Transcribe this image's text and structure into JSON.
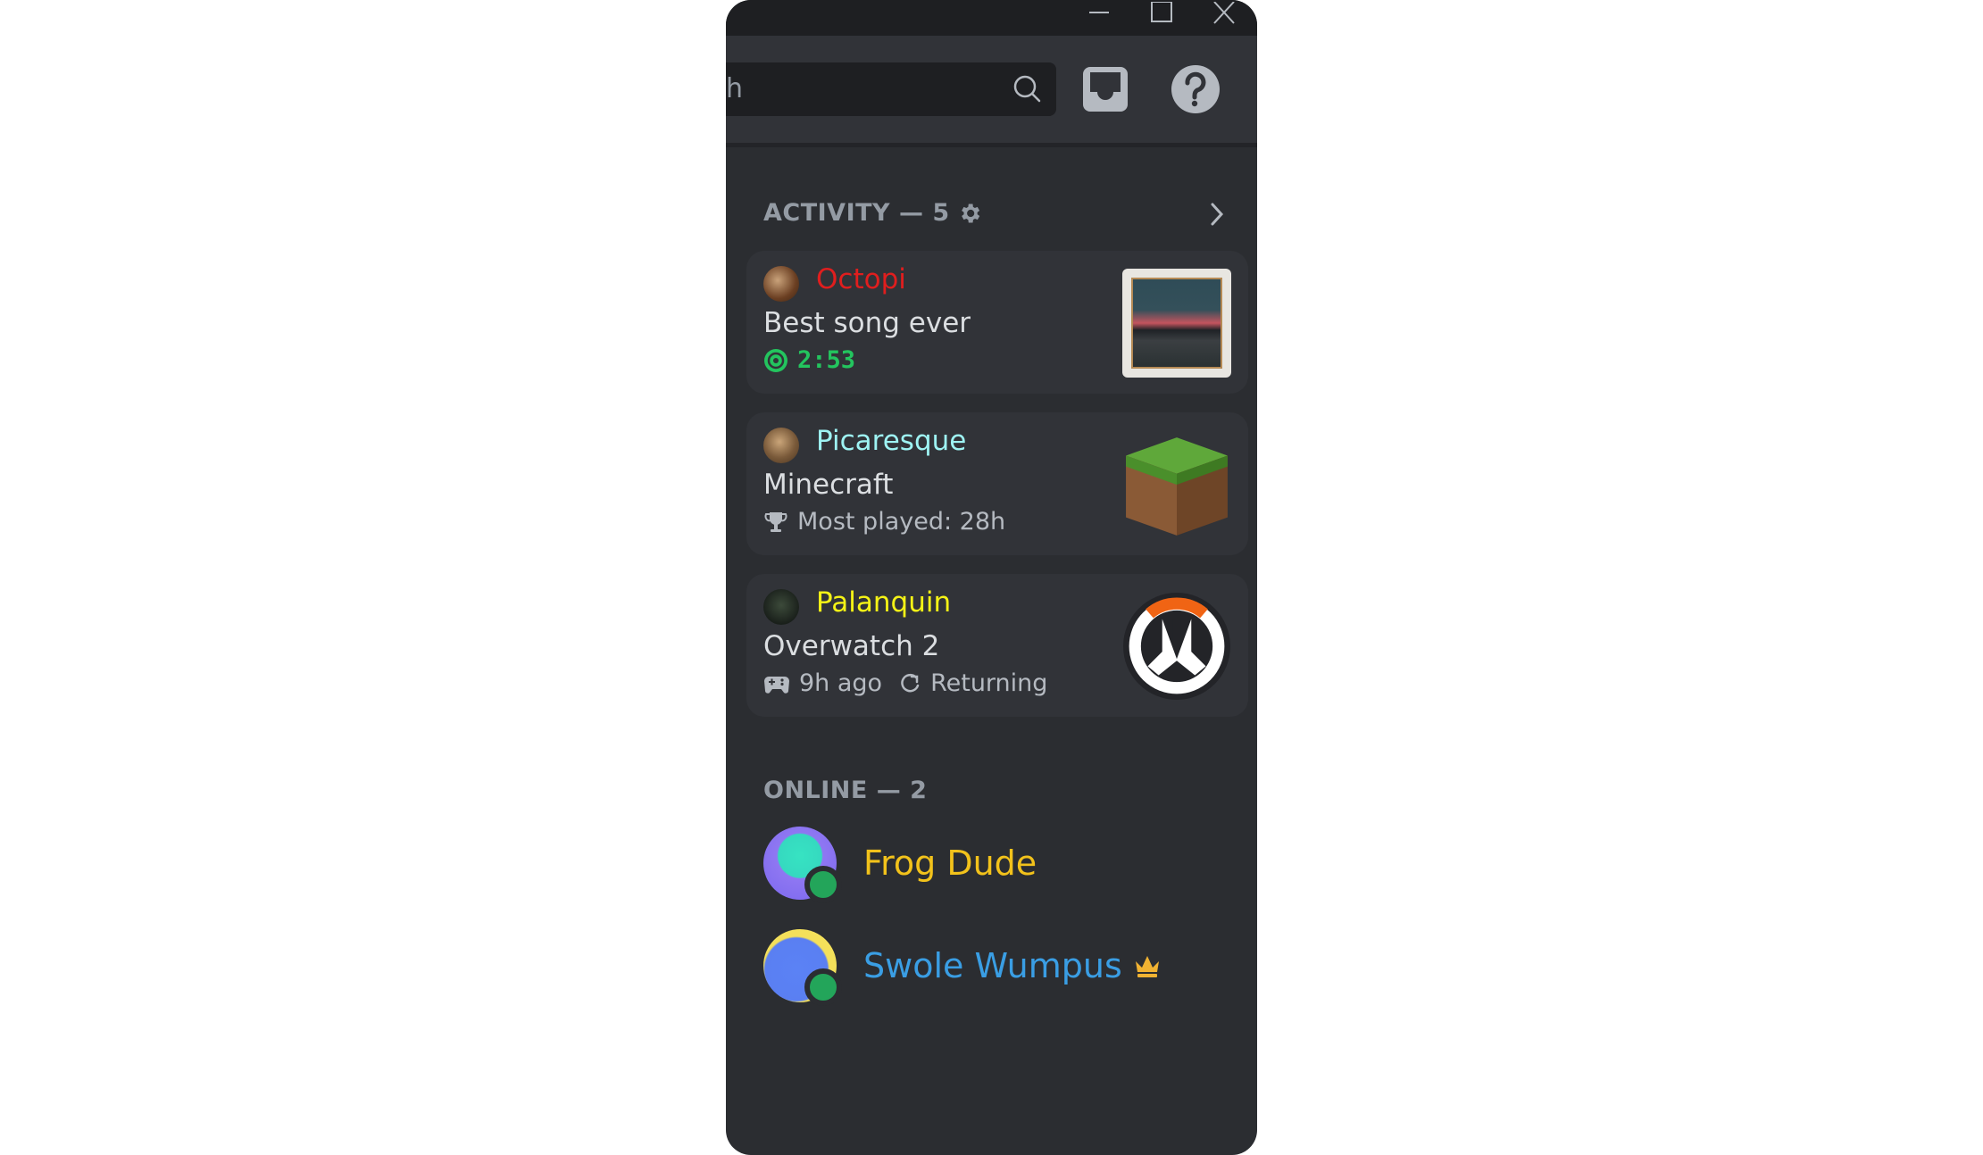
{
  "window": {
    "controls": {
      "minimize": "minimize",
      "maximize": "maximize",
      "close": "close"
    }
  },
  "toolbar": {
    "search_placeholder": "h",
    "icons": [
      "search-icon",
      "inbox-icon",
      "help-icon"
    ]
  },
  "activity": {
    "header": "ACTIVITY — 5",
    "items": [
      {
        "username": "Octopi",
        "username_color": "#e01e1e",
        "title": "Best song ever",
        "meta": "2:53",
        "meta_color": "#23c45e",
        "meta_icon": "music-disc-icon",
        "art": "album-art"
      },
      {
        "username": "Picaresque",
        "username_color": "#9ef3f3",
        "title": "Minecraft",
        "meta": "Most played: 28h",
        "meta_icon": "trophy-icon",
        "art": "minecraft-logo"
      },
      {
        "username": "Palanquin",
        "username_color": "#f5f316",
        "title": "Overwatch 2",
        "meta": "9h ago",
        "meta_icon": "gamepad-icon",
        "meta2": "Returning",
        "meta2_icon": "refresh-icon",
        "art": "overwatch-logo"
      }
    ]
  },
  "online": {
    "header": "ONLINE — 2",
    "members": [
      {
        "name": "Frog Dude",
        "color": "#f2c21b",
        "status": "online"
      },
      {
        "name": "Swole Wumpus",
        "color": "#3a9ee4",
        "status": "online",
        "badge": "crown-icon"
      }
    ]
  },
  "colors": {
    "online_status": "#23a55a",
    "crown": "#f0b232",
    "accent_green": "#23c45e"
  }
}
